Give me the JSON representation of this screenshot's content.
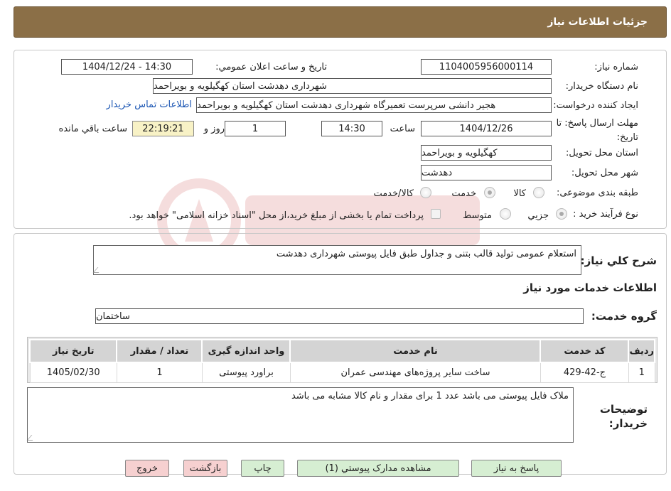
{
  "header": {
    "title": "جزئیات اطلاعات نیاز"
  },
  "form": {
    "need_number_label": "شماره نیاز:",
    "need_number": "1104005956000114",
    "announce_label": "تاریخ و ساعت اعلان عمومي:",
    "announce_value": "1404/12/24 - 14:30",
    "buyer_org_label": "نام دستگاه خريدار:",
    "buyer_org": "شهرداری دهدشت استان کهگیلویه و بویراحمد",
    "requester_label": "ايجاد کننده درخواست:",
    "requester": "هجیر دانشی سرپرست تعمیرگاه شهرداری دهدشت استان کهگیلویه و بویراحمد",
    "contact_link": "اطلاعات تماس خریدار",
    "deadline_label": "مهلت ارسال پاسخ: تا تاریخ:",
    "deadline_date": "1404/12/26",
    "time_label": "ساعت",
    "deadline_time": "14:30",
    "days": "1",
    "days_label": "روز و",
    "remaining": "22:19:21",
    "remaining_label": "ساعت باقي مانده",
    "province_label": "استان محل تحویل:",
    "province": "کهگیلویه و بویراحمد",
    "city_label": "شهر محل تحویل:",
    "city": "دهدشت",
    "category_label": "طبقه بندی موضوعی:",
    "category_options": [
      "کالا",
      "خدمت",
      "کالا/خدمت"
    ],
    "category_selected": "خدمت",
    "process_label": "نوع فرآیند خرید :",
    "process_options": [
      "جزیي",
      "متوسط"
    ],
    "process_selected": "جزیي",
    "payment_note": "پرداخت تمام یا بخشی از مبلغ خرید،از محل \"اسناد خزانه اسلامی\" خواهد بود."
  },
  "description": {
    "label": "شرح کلي نياز:",
    "text": "استعلام عمومی تولید قالب بتنی و جداول طبق فایل پیوستی شهرداری دهدشت"
  },
  "services": {
    "heading": "اطلاعات خدمات مورد نياز",
    "group_label": "گروه خدمت:",
    "group": "ساختمان",
    "columns": [
      "رديف",
      "کد خدمت",
      "نام خدمت",
      "واحد اندازه گيری",
      "تعداد / مقدار",
      "تاریخ نیاز"
    ],
    "rows": [
      [
        "1",
        "ج-42-429",
        "ساخت سایر پروژه‌های مهندسی عمران",
        "براورد پیوستی",
        "1",
        "1405/02/30"
      ]
    ]
  },
  "buyer_notes": {
    "label": "توضيحات خريدار:",
    "text": "ملاک فایل پیوستی می باشد عدد 1 برای مقدار و نام کالا مشابه می باشد"
  },
  "buttons": {
    "reply": "پاسخ به نياز",
    "attachments": "مشاهده مدارک پيوستي (1)",
    "print": "چاپ",
    "back": "بازگشت",
    "exit": "خروج"
  },
  "colors": {
    "header_bg": "#8b6f47",
    "button_green": "#d6eed2",
    "button_red": "#f6d0d0",
    "link": "#1a55b3"
  }
}
